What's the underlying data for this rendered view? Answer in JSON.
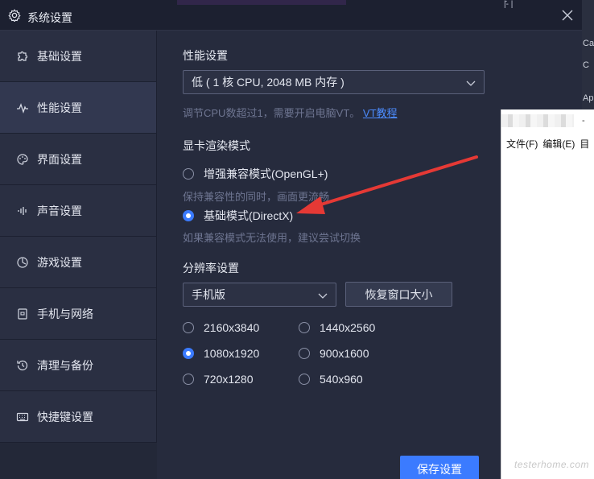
{
  "window": {
    "title": "系统设置",
    "top_mark": "|̄- |"
  },
  "sidebar": {
    "items": [
      {
        "label": "基础设置",
        "icon": "puzzle-icon"
      },
      {
        "label": "性能设置",
        "icon": "pulse-icon",
        "active": true
      },
      {
        "label": "界面设置",
        "icon": "palette-icon"
      },
      {
        "label": "声音设置",
        "icon": "sound-icon"
      },
      {
        "label": "游戏设置",
        "icon": "game-icon"
      },
      {
        "label": "手机与网络",
        "icon": "phone-icon"
      },
      {
        "label": "清理与备份",
        "icon": "history-icon"
      },
      {
        "label": "快捷键设置",
        "icon": "keyboard-icon"
      }
    ]
  },
  "performance": {
    "title": "性能设置",
    "select_value": "低 ( 1 核 CPU, 2048 MB 内存 )",
    "hint": "调节CPU数超过1，需要开启电脑VT。",
    "hint_link": "VT教程"
  },
  "render": {
    "title": "显卡渲染模式",
    "option1": "增强兼容模式(OpenGL+)",
    "option1_hint": "保持兼容性的同时，画面更流畅",
    "option2": "基础模式(DirectX)",
    "option2_hint": "如果兼容模式无法使用，建议尝试切换",
    "selected": "option2"
  },
  "resolution": {
    "title": "分辨率设置",
    "select_value": "手机版",
    "restore_button": "恢复窗口大小",
    "options": [
      "2160x3840",
      "1440x2560",
      "1080x1920",
      "900x1600",
      "720x1280",
      "540x960"
    ],
    "selected": "1080x1920"
  },
  "footer": {
    "save_button": "保存设置"
  },
  "background_window": {
    "letters": [
      "Ca",
      "C",
      "Ap"
    ]
  },
  "notepad": {
    "title_fragment": "-",
    "menu": [
      "文件(F)",
      "编辑(E)",
      "目"
    ],
    "watermark": "testerhome.com"
  },
  "colors": {
    "accent": "#3b7bff",
    "annotation_arrow": "#e53935"
  }
}
